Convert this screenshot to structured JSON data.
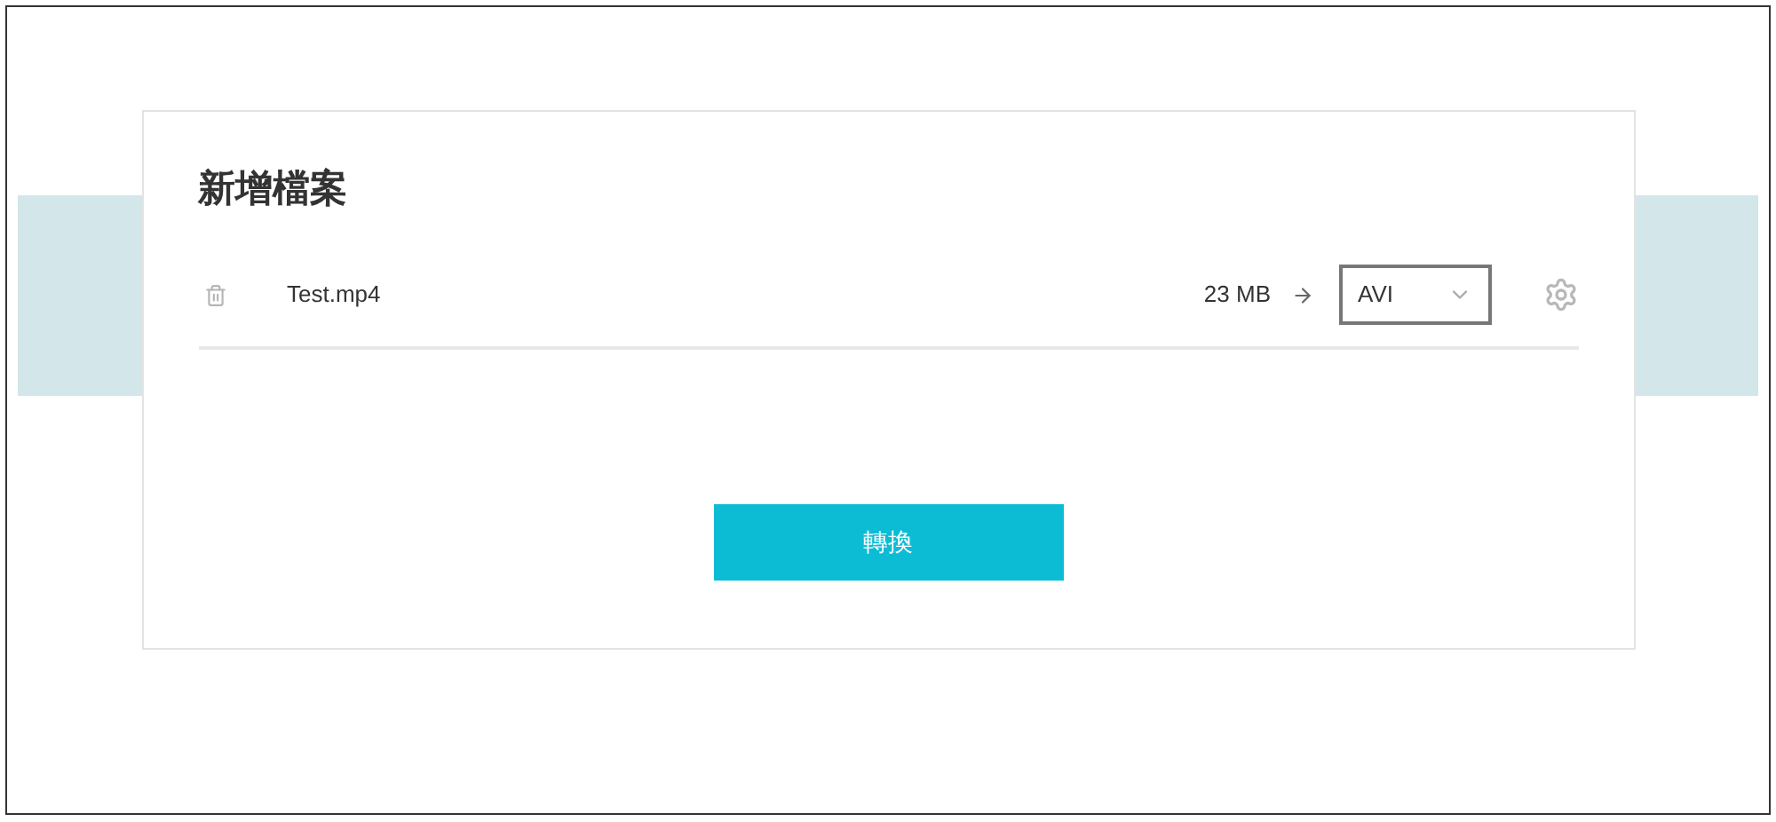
{
  "panel": {
    "title": "新增檔案"
  },
  "files": [
    {
      "name": "Test.mp4",
      "size": "23 MB",
      "format": "AVI"
    }
  ],
  "convert_button": "轉換"
}
